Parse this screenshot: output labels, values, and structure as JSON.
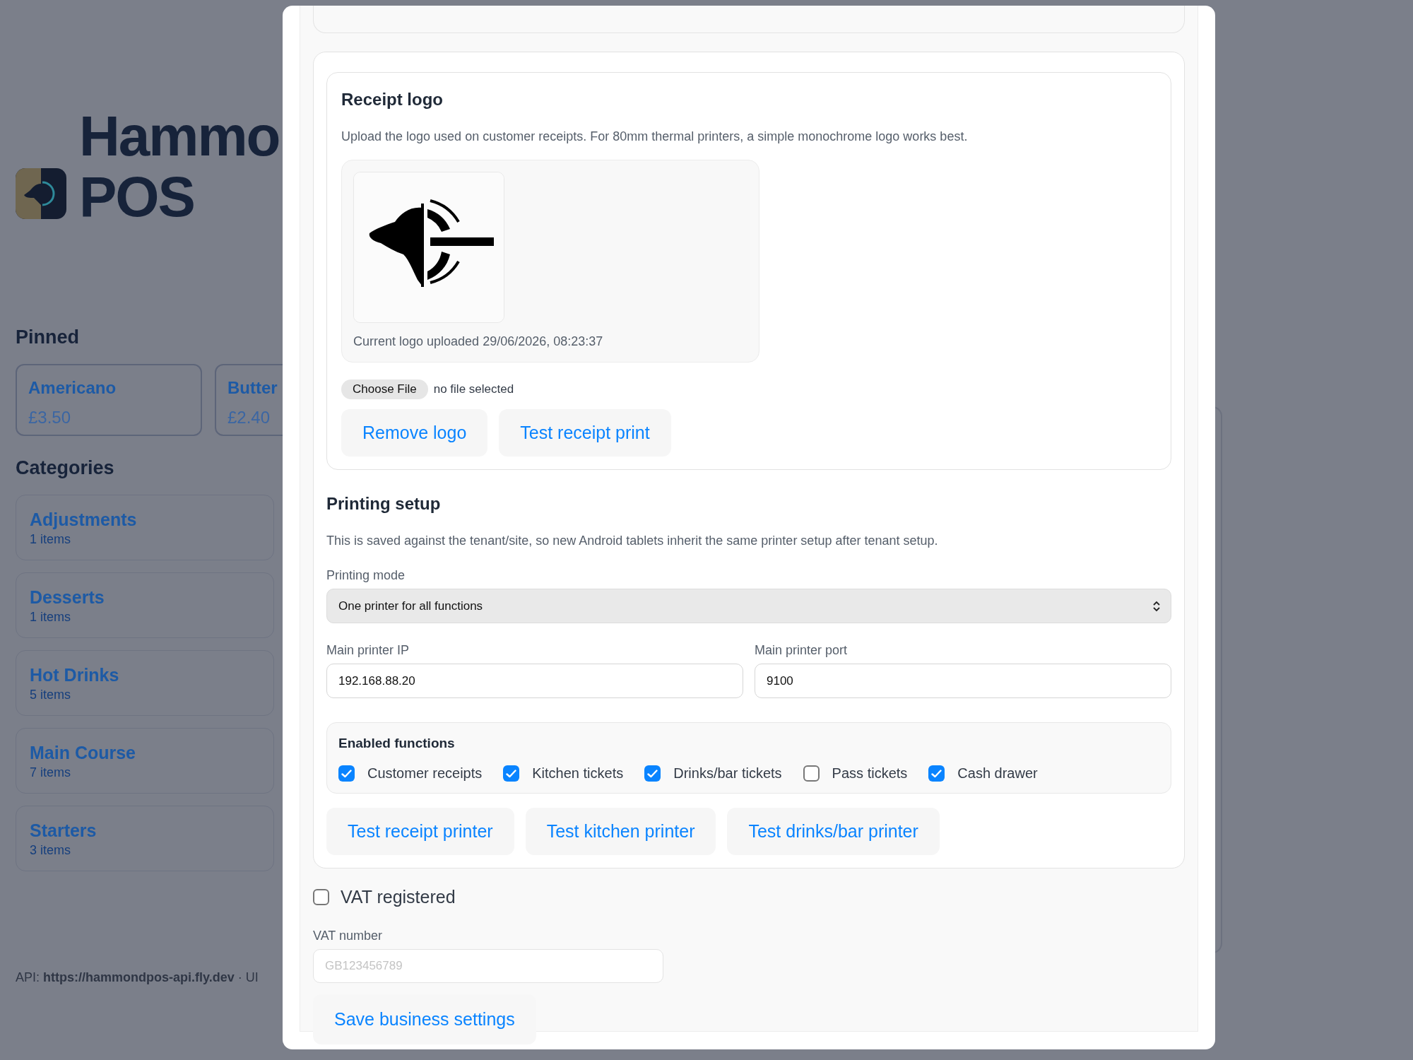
{
  "background": {
    "title_lines": [
      "Hammo",
      "POS"
    ],
    "pinned_heading": "Pinned",
    "pinned": [
      {
        "name": "Americano",
        "price": "£3.50"
      },
      {
        "name": "Butter",
        "price": "£2.40"
      }
    ],
    "categories_heading": "Categories",
    "categories": [
      {
        "name": "Adjustments",
        "count": "1 items"
      },
      {
        "name": "Desserts",
        "count": "1 items"
      },
      {
        "name": "Hot Drinks",
        "count": "5 items"
      },
      {
        "name": "Main Course",
        "count": "7 items"
      },
      {
        "name": "Starters",
        "count": "3 items"
      }
    ],
    "footer": "API: **https://hammondpos-api.fly.dev** · UI"
  },
  "modal": {
    "receipt_logo": {
      "title": "Receipt logo",
      "description": "Upload the logo used on customer receipts. For 80mm thermal printers, a simple monochrome logo works best.",
      "preview": {
        "kind": "picture"
      },
      "uploaded_caption": "Current logo uploaded 29/06/2026, 08:23:37",
      "file_button": "Choose File",
      "file_status": "no file selected",
      "buttons": [
        "Remove logo",
        "Test receipt print"
      ]
    },
    "printing_setup": {
      "title": "Printing setup",
      "description": "This is saved against the tenant/site, so new Android tablets inherit the same printer setup after tenant setup.",
      "mode_label": "Printing mode",
      "mode_value": "One printer for all functions",
      "fields": [
        {
          "label": "Main printer IP",
          "value": "192.168.88.20"
        },
        {
          "label": "Main printer port",
          "value": "9100"
        }
      ],
      "functions_title": "Enabled functions",
      "functions": [
        {
          "label": "Customer receipts",
          "checked": true
        },
        {
          "label": "Kitchen tickets",
          "checked": true
        },
        {
          "label": "Drinks/bar tickets",
          "checked": true
        },
        {
          "label": "Pass tickets",
          "checked": false
        },
        {
          "label": "Cash drawer",
          "checked": true
        }
      ],
      "buttons": [
        "Test receipt printer",
        "Test kitchen printer",
        "Test drinks/bar printer"
      ]
    },
    "vat_registered": {
      "label": "VAT registered",
      "checked": false
    },
    "vat_number": {
      "label": "VAT number",
      "placeholder": "GB123456789"
    },
    "save_button": "Save business settings"
  }
}
